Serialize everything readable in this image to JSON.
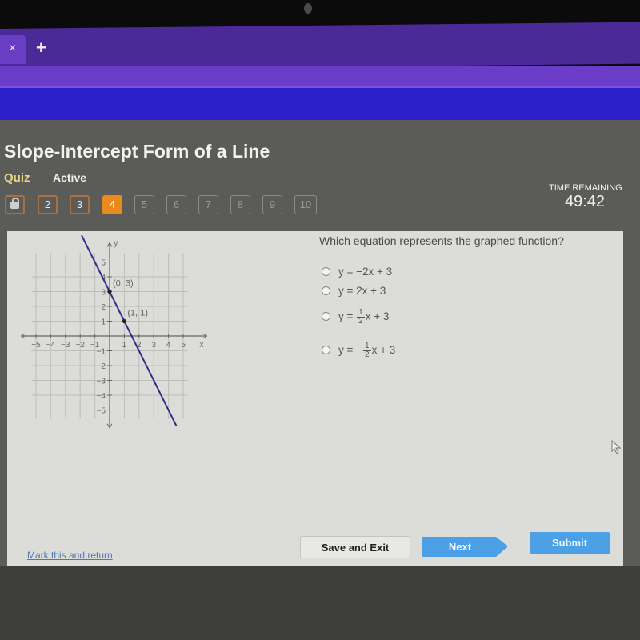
{
  "browser": {
    "tab_close_glyph": "×",
    "new_tab_glyph": "+"
  },
  "header": {
    "title": "Slope-Intercept Form of a Line",
    "type_label": "Quiz",
    "status_label": "Active"
  },
  "question_nav": {
    "items": [
      {
        "label": "",
        "state": "locked",
        "icon": "lock-icon"
      },
      {
        "label": "2",
        "state": "answered"
      },
      {
        "label": "3",
        "state": "answered"
      },
      {
        "label": "4",
        "state": "current"
      },
      {
        "label": "5",
        "state": "future"
      },
      {
        "label": "6",
        "state": "future"
      },
      {
        "label": "7",
        "state": "future"
      },
      {
        "label": "8",
        "state": "future"
      },
      {
        "label": "9",
        "state": "future"
      },
      {
        "label": "10",
        "state": "future"
      }
    ]
  },
  "timer": {
    "label": "TIME REMAINING",
    "value": "49:42"
  },
  "question": {
    "text": "Which equation represents the graphed function?",
    "options": [
      {
        "prefix": "y = −2x + 3",
        "fraction": null,
        "suffix": ""
      },
      {
        "prefix": "y = 2x + 3",
        "fraction": null,
        "suffix": ""
      },
      {
        "prefix": "y = ",
        "fraction": {
          "sign": "",
          "num": "1",
          "den": "2"
        },
        "suffix": "x + 3"
      },
      {
        "prefix": "y = ",
        "fraction": {
          "sign": "−",
          "num": "1",
          "den": "2"
        },
        "suffix": "x + 3"
      }
    ]
  },
  "graph": {
    "x_axis_label": "x",
    "y_axis_label": "y",
    "x_ticks": [
      "−5",
      "−4",
      "−3",
      "−2",
      "−1",
      "1",
      "2",
      "3",
      "4",
      "5"
    ],
    "y_ticks": [
      "5",
      "4",
      "3",
      "2",
      "1",
      "−1",
      "−2",
      "−3",
      "−4",
      "−5"
    ],
    "range": {
      "xmin": -5,
      "xmax": 5,
      "ymin": -5,
      "ymax": 5
    },
    "line": {
      "slope": -2,
      "intercept": 3,
      "color": "#2b2f8f"
    },
    "points": [
      {
        "x": 0,
        "y": 3,
        "label": "(0, 3)"
      },
      {
        "x": 1,
        "y": 1,
        "label": "(1, 1)"
      }
    ]
  },
  "footer": {
    "mark_link": "Mark this and return",
    "save_exit": "Save and Exit",
    "next": "Next",
    "submit": "Submit"
  },
  "colors": {
    "accent_orange": "#ea8a1c",
    "button_blue": "#4ba0e6",
    "link_blue": "#4a7bb8"
  }
}
